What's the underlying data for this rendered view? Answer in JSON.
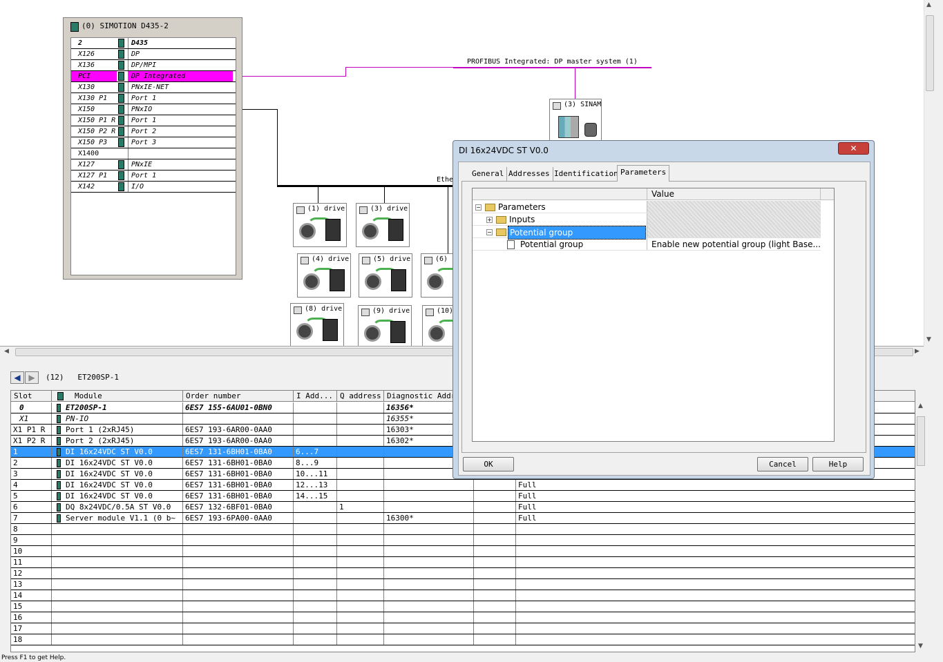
{
  "rack": {
    "title": "(0) SIMOTION D435-2",
    "rows": [
      {
        "slot": "2",
        "module": "D435"
      },
      {
        "slot": "X126",
        "module": "DP"
      },
      {
        "slot": "X136",
        "module": "DP/MPI"
      },
      {
        "slot": "PCI",
        "module": "DP Integrated"
      },
      {
        "slot": "X130",
        "module": "PNxIE-NET"
      },
      {
        "slot": "X130 P1",
        "module": "Port 1"
      },
      {
        "slot": "X150",
        "module": "PNxIO"
      },
      {
        "slot": "X150 P1 R",
        "module": "Port 1"
      },
      {
        "slot": "X150 P2 R",
        "module": "Port 2"
      },
      {
        "slot": "X150 P3",
        "module": "Port 3"
      },
      {
        "slot": "X1400",
        "module": ""
      },
      {
        "slot": "X127",
        "module": "PNxIE"
      },
      {
        "slot": "X127 P1",
        "module": "Port 1"
      },
      {
        "slot": "X142",
        "module": "I/O"
      }
    ]
  },
  "network": {
    "profibus_label": "PROFIBUS Integrated: DP master system (1)",
    "ethernet_label": "Ethe",
    "sinamics_label": "(3) SINAM",
    "drives": [
      {
        "label": "(1) drive"
      },
      {
        "label": "(3) drive"
      },
      {
        "label": "(4) drive"
      },
      {
        "label": "(5) drive"
      },
      {
        "label": "(6)"
      },
      {
        "label": "(8) drive"
      },
      {
        "label": "(9) drive"
      },
      {
        "label": "(10)"
      }
    ]
  },
  "station": {
    "nav_back": "◀",
    "nav_forward": "▶",
    "title": "(12)   ET200SP-1"
  },
  "table": {
    "headers": {
      "slot": "Slot",
      "module": "Module",
      "order": "Order number",
      "iaddr": "I Add...",
      "qaddr": "Q address",
      "diag": "Diagnostic Addre"
    },
    "rows": [
      {
        "slot": "0",
        "module": "ET200SP-1",
        "order": "6ES7 155-6AU01-0BN0",
        "iaddr": "",
        "qaddr": "",
        "diag": "16356*",
        "extra": ""
      },
      {
        "slot": "X1",
        "module": "PN-IO",
        "order": "",
        "iaddr": "",
        "qaddr": "",
        "diag": "16355*",
        "extra": ""
      },
      {
        "slot": "X1 P1 R",
        "module": "Port 1 (2xRJ45)",
        "order": "6ES7 193-6AR00-0AA0",
        "iaddr": "",
        "qaddr": "",
        "diag": "16303*",
        "extra": ""
      },
      {
        "slot": "X1 P2 R",
        "module": "Port 2 (2xRJ45)",
        "order": "6ES7 193-6AR00-0AA0",
        "iaddr": "",
        "qaddr": "",
        "diag": "16302*",
        "extra": ""
      },
      {
        "slot": "1",
        "module": "DI 16x24VDC ST V0.0",
        "order": "6ES7 131-6BH01-0BA0",
        "iaddr": "6...7",
        "qaddr": "",
        "diag": "",
        "extra": ""
      },
      {
        "slot": "2",
        "module": "DI 16x24VDC ST V0.0",
        "order": "6ES7 131-6BH01-0BA0",
        "iaddr": "8...9",
        "qaddr": "",
        "diag": "",
        "extra": ""
      },
      {
        "slot": "3",
        "module": "DI 16x24VDC ST V0.0",
        "order": "6ES7 131-6BH01-0BA0",
        "iaddr": "10...11",
        "qaddr": "",
        "diag": "",
        "extra": ""
      },
      {
        "slot": "4",
        "module": "DI 16x24VDC ST V0.0",
        "order": "6ES7 131-6BH01-0BA0",
        "iaddr": "12...13",
        "qaddr": "",
        "diag": "",
        "extra": "Full"
      },
      {
        "slot": "5",
        "module": "DI 16x24VDC ST V0.0",
        "order": "6ES7 131-6BH01-0BA0",
        "iaddr": "14...15",
        "qaddr": "",
        "diag": "",
        "extra": "Full"
      },
      {
        "slot": "6",
        "module": "DQ 8x24VDC/0.5A ST V0.0",
        "order": "6ES7 132-6BF01-0BA0",
        "iaddr": "",
        "qaddr": "1",
        "diag": "",
        "extra": "Full"
      },
      {
        "slot": "7",
        "module": "Server module V1.1  (0 b~",
        "order": "6ES7 193-6PA00-0AA0",
        "iaddr": "",
        "qaddr": "",
        "diag": "16300*",
        "extra": "Full"
      },
      {
        "slot": "8",
        "module": "",
        "order": "",
        "iaddr": "",
        "qaddr": "",
        "diag": "",
        "extra": ""
      },
      {
        "slot": "9",
        "module": "",
        "order": "",
        "iaddr": "",
        "qaddr": "",
        "diag": "",
        "extra": ""
      },
      {
        "slot": "10",
        "module": "",
        "order": "",
        "iaddr": "",
        "qaddr": "",
        "diag": "",
        "extra": ""
      },
      {
        "slot": "11",
        "module": "",
        "order": "",
        "iaddr": "",
        "qaddr": "",
        "diag": "",
        "extra": ""
      },
      {
        "slot": "12",
        "module": "",
        "order": "",
        "iaddr": "",
        "qaddr": "",
        "diag": "",
        "extra": ""
      },
      {
        "slot": "13",
        "module": "",
        "order": "",
        "iaddr": "",
        "qaddr": "",
        "diag": "",
        "extra": ""
      },
      {
        "slot": "14",
        "module": "",
        "order": "",
        "iaddr": "",
        "qaddr": "",
        "diag": "",
        "extra": ""
      },
      {
        "slot": "15",
        "module": "",
        "order": "",
        "iaddr": "",
        "qaddr": "",
        "diag": "",
        "extra": ""
      },
      {
        "slot": "16",
        "module": "",
        "order": "",
        "iaddr": "",
        "qaddr": "",
        "diag": "",
        "extra": ""
      },
      {
        "slot": "17",
        "module": "",
        "order": "",
        "iaddr": "",
        "qaddr": "",
        "diag": "",
        "extra": ""
      },
      {
        "slot": "18",
        "module": "",
        "order": "",
        "iaddr": "",
        "qaddr": "",
        "diag": "",
        "extra": ""
      }
    ]
  },
  "dialog": {
    "title": "DI 16x24VDC ST V0.0",
    "close": "✕",
    "tabs": [
      "General",
      "Addresses",
      "Identification",
      "Parameters"
    ],
    "value_header": "Value",
    "tree": {
      "root": "Parameters",
      "inputs": "Inputs",
      "potential_group": "Potential group",
      "potential_group_param": "Potential group",
      "potential_group_value": "Enable new potential group (light Base..."
    },
    "ok": "OK",
    "cancel": "Cancel",
    "help": "Help"
  },
  "status_bar": "Press F1 to get Help.",
  "colors": {
    "selection": "#3399ff",
    "highlight": "#ff00ff",
    "profibus_line": "#c000c0",
    "dialog_frame": "#c8d8e8"
  }
}
